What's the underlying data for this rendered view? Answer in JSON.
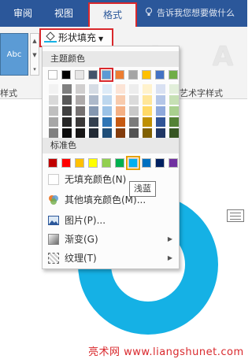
{
  "tabs": {
    "review": "审阅",
    "view": "视图",
    "format": "格式",
    "tell_me": "告诉我您想要做什么"
  },
  "ribbon": {
    "style_preview": "Abc",
    "styles_label": "样式",
    "art_text_label": "艺术字样式",
    "art_letter": "A",
    "shape_fill_label": "形状填充"
  },
  "dropdown": {
    "theme_colors_header": "主题颜色",
    "standard_colors_header": "标准色",
    "theme_top": [
      "#ffffff",
      "#000000",
      "#e7e6e6",
      "#44546a",
      "#5b9bd5",
      "#ed7d31",
      "#a5a5a5",
      "#ffc000",
      "#4472c4",
      "#70ad47"
    ],
    "theme_shades": [
      [
        "#f2f2f2",
        "#d9d9d9",
        "#bfbfbf",
        "#a6a6a6",
        "#808080"
      ],
      [
        "#7f7f7f",
        "#595959",
        "#404040",
        "#262626",
        "#0d0d0d"
      ],
      [
        "#d0cece",
        "#aeaaaa",
        "#757171",
        "#3a3838",
        "#171616"
      ],
      [
        "#d6dce4",
        "#adb9ca",
        "#8497b0",
        "#333f4f",
        "#222a35"
      ],
      [
        "#ddebf7",
        "#bdd7ee",
        "#9bc2e6",
        "#2f75b5",
        "#1f4e78"
      ],
      [
        "#fce4d6",
        "#f8cbad",
        "#f4b084",
        "#c65911",
        "#833c0c"
      ],
      [
        "#ededed",
        "#dbdbdb",
        "#c9c9c9",
        "#7b7b7b",
        "#525252"
      ],
      [
        "#fff2cc",
        "#ffe699",
        "#ffd966",
        "#bf8f00",
        "#806000"
      ],
      [
        "#d9e1f2",
        "#b4c6e7",
        "#8ea9db",
        "#305496",
        "#203764"
      ],
      [
        "#e2efda",
        "#c6e0b4",
        "#a9d08e",
        "#548235",
        "#375623"
      ]
    ],
    "standard": [
      "#c00000",
      "#ff0000",
      "#ffc000",
      "#ffff00",
      "#92d050",
      "#00b050",
      "#00b0f0",
      "#0070c0",
      "#002060",
      "#7030a0"
    ],
    "no_fill": "无填充颜色(N)",
    "more_colors": "其他填充颜色(M)...",
    "picture": "图片(P)...",
    "gradient": "渐变(G)",
    "texture": "纹理(T)",
    "tooltip": "浅蓝"
  },
  "shape": {
    "fill_color": "#15b1e5"
  },
  "watermark": "亮术网 www.liangshunet.com"
}
